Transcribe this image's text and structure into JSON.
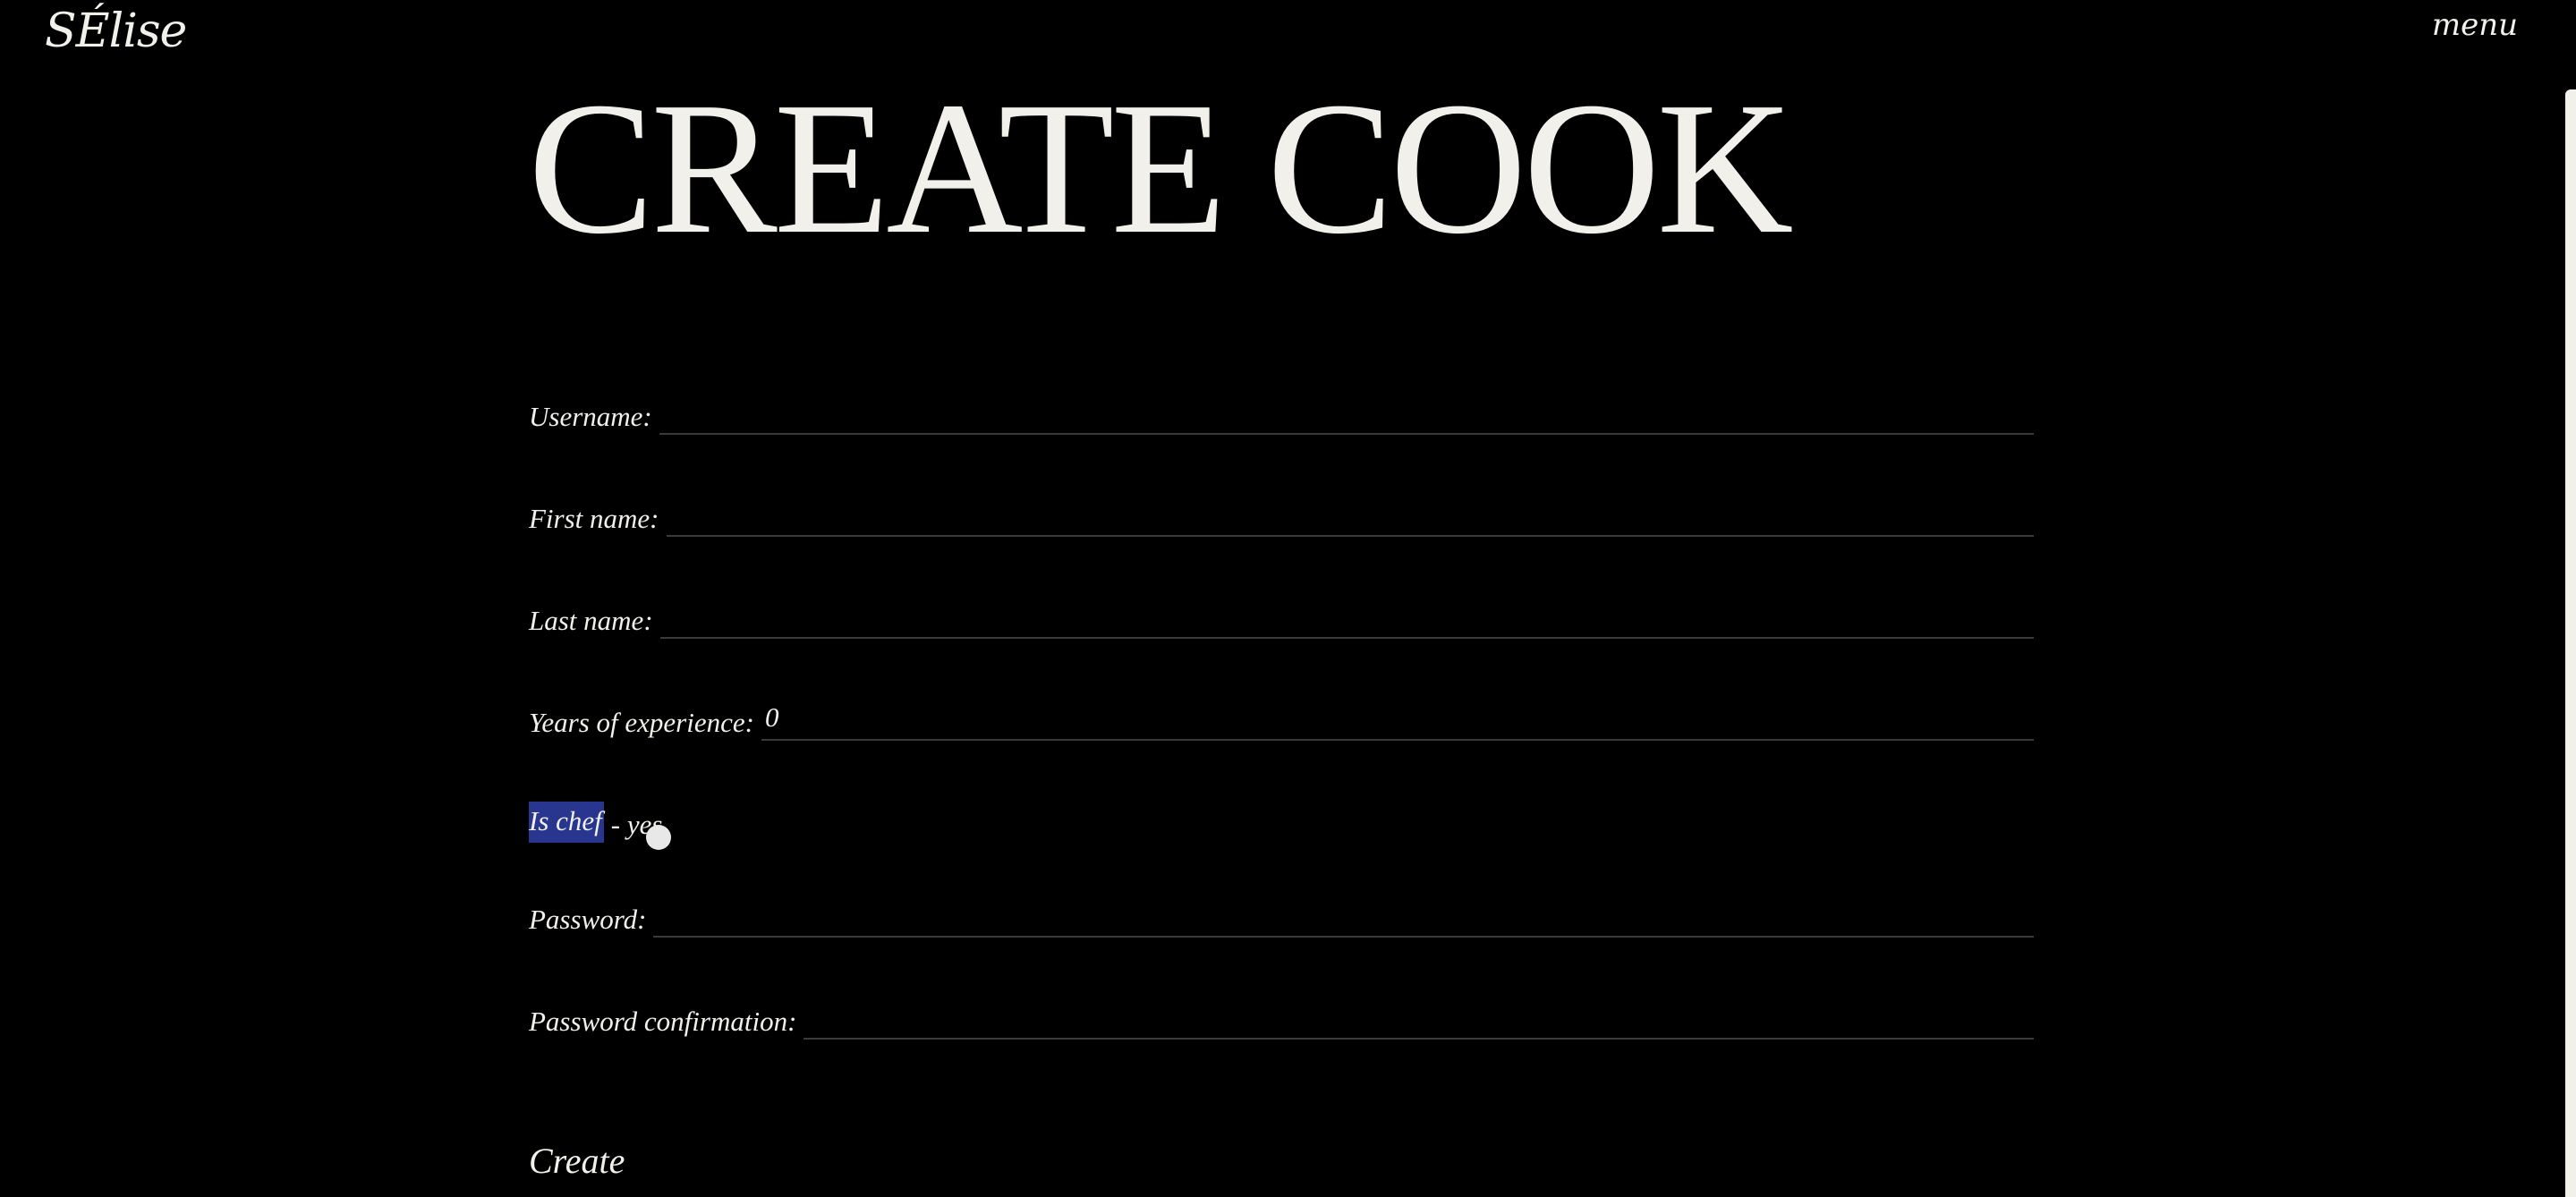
{
  "header": {
    "logo": "SÉlise",
    "menu_label": "menu"
  },
  "page": {
    "title": "CREATE COOK"
  },
  "form": {
    "username": {
      "label": "Username:",
      "value": ""
    },
    "first_name": {
      "label": "First name:",
      "value": ""
    },
    "last_name": {
      "label": "Last name:",
      "value": ""
    },
    "experience": {
      "label": "Years of experience:",
      "value": "0"
    },
    "is_chef": {
      "label": "Is chef",
      "value": "- yes"
    },
    "password": {
      "label": "Password:",
      "value": ""
    },
    "password_confirmation": {
      "label": "Password confirmation:",
      "value": ""
    },
    "submit_label": "Create"
  },
  "colors": {
    "background": "#000000",
    "text": "#f2f0ea",
    "selection": "#29368f",
    "underline": "#3a3a3a"
  }
}
